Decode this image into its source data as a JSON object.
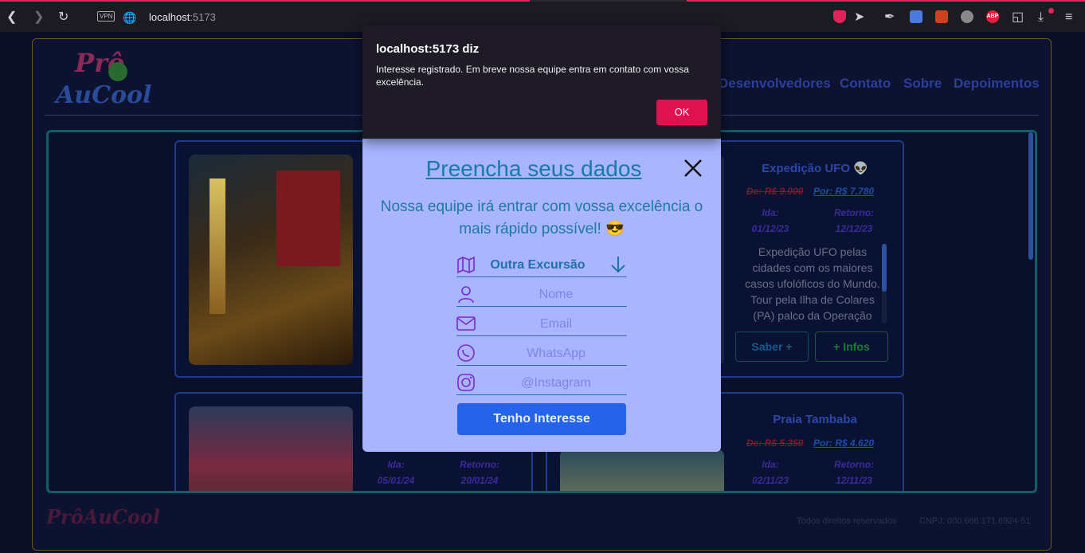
{
  "browser": {
    "vpn_label": "VPN",
    "url_host": "localhost",
    "url_port": ":5173"
  },
  "header": {
    "logo_top": "Prô",
    "logo_bottom": "AuCool",
    "nav": [
      "Desenvolvedores",
      "Contato",
      "Sobre",
      "Depoimentos"
    ]
  },
  "cards": [
    {
      "title": "Expedição UFO 👽",
      "old_price": "De: R$ 9.000",
      "new_price": "Por: R$ 7.780",
      "departure_label": "Ida:",
      "departure": "01/12/23",
      "return_label": "Retorno:",
      "return": "12/12/23",
      "description": "Expedição UFO pelas cidades com os maiores casos ufolóficos do Mundo. Tour pela Ilha de Colares (PA) palco da Operação",
      "btn_more": "Saber +",
      "btn_info": "+ Infos"
    },
    {
      "title": "Praia Tambaba",
      "old_price": "De: R$ 5.350",
      "new_price": "Por: R$ 4.620",
      "departure_label": "Ida:",
      "departure": "02/11/23",
      "return_label": "Retorno:",
      "return": "12/11/23"
    },
    {
      "departure_label": "Ida:",
      "departure": "05/01/24",
      "return_label": "Retorno:",
      "return": "20/01/24"
    }
  ],
  "footer": {
    "logo": "PrôAuCool",
    "rights": "Todos direitos reservados",
    "cnpj": "CNPJ: 000.666.171.6924-51"
  },
  "modal": {
    "title": "Preencha seus dados",
    "subtitle": "Nossa equipe irá entrar com vossa excelência o mais rápido possível! 😎",
    "excursion_selected": "Outra Excursão",
    "name_placeholder": "Nome",
    "email_placeholder": "Email",
    "whatsapp_placeholder": "WhatsApp",
    "instagram_placeholder": "@Instagram",
    "submit_label": "Tenho Interesse"
  },
  "alert": {
    "title": "localhost:5173 diz",
    "message": "Interesse registrado. Em breve nossa equipe entra em contato com vossa excelência.",
    "ok_label": "OK"
  },
  "colors": {
    "accent": "#e0114f",
    "modal_bg": "#a9b5ff",
    "submit": "#2563eb"
  }
}
